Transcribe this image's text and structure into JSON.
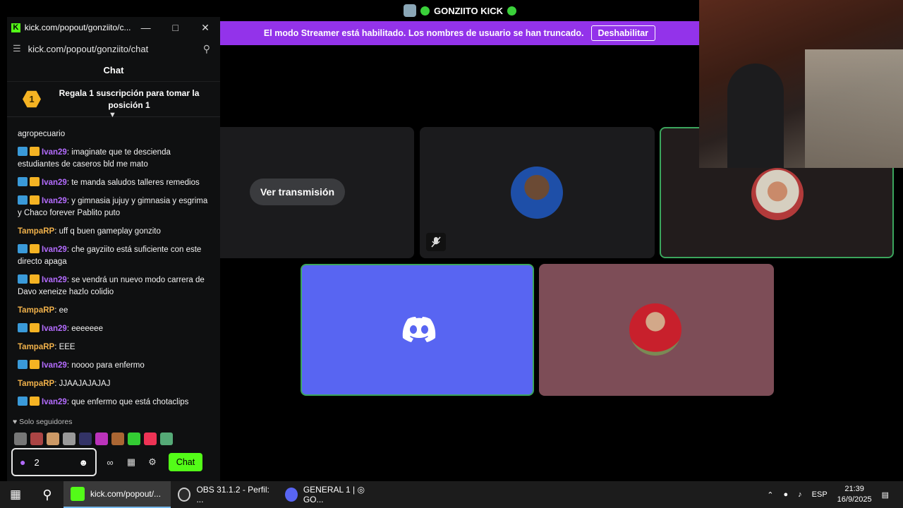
{
  "stage": {
    "channel_name": "GONZIITO KICK",
    "streamer_notice": "El modo Streamer está habilitado. Los nombres de usuario se han truncado.",
    "disable_button": "Deshabilitar",
    "watch_stream_button": "Ver transmisión"
  },
  "chat_window": {
    "title": "kick.com/popout/gonziito/c...",
    "url": "kick.com/popout/gonziito/chat",
    "panel_title": "Chat",
    "pinned": {
      "badge": "1",
      "text": "Regala 1 suscripción para tomar la posición 1"
    },
    "messages": [
      {
        "icons": false,
        "user": "",
        "text": "agropecuario",
        "color": "#ffffff"
      },
      {
        "icons": true,
        "user": "Ivan29",
        "text": ": imaginate que te descienda estudiantes de caseros bld me mato",
        "color": "#b46cff"
      },
      {
        "icons": true,
        "user": "Ivan29",
        "text": ": te manda saludos talleres remedios",
        "color": "#b46cff"
      },
      {
        "icons": true,
        "user": "Ivan29",
        "text": ": y gimnasia jujuy y gimnasia y esgrima y Chaco forever Pablito puto",
        "color": "#b46cff"
      },
      {
        "icons": false,
        "user": "TampaRP",
        "text": ": uff q buen gameplay gonzito",
        "color": "#f0b14a"
      },
      {
        "icons": true,
        "user": "Ivan29",
        "text": ": che gayziito está suficiente con este directo apaga",
        "color": "#b46cff"
      },
      {
        "icons": true,
        "user": "Ivan29",
        "text": ": se vendrá un nuevo modo carrera de Davo xeneize hazlo colidio",
        "color": "#b46cff"
      },
      {
        "icons": false,
        "user": "TampaRP",
        "text": ": ee",
        "color": "#f0b14a"
      },
      {
        "icons": true,
        "user": "Ivan29",
        "text": ": eeeeeee",
        "color": "#b46cff"
      },
      {
        "icons": false,
        "user": "TampaRP",
        "text": ": EEE",
        "color": "#f0b14a"
      },
      {
        "icons": true,
        "user": "Ivan29",
        "text": ": noooo para enfermo",
        "color": "#b46cff"
      },
      {
        "icons": false,
        "user": "TampaRP",
        "text": ": JJAAJAJAJAJ",
        "color": "#f0b14a"
      },
      {
        "icons": true,
        "user": "Ivan29",
        "text": ": que enfermo que está chotaclips",
        "color": "#b46cff"
      }
    ],
    "followers_only": "Solo seguidores",
    "input_count": "2",
    "send_button": "Chat"
  },
  "taskbar": {
    "apps": [
      {
        "label": "kick.com/popout/...",
        "icon_color": "#53fc18"
      },
      {
        "label": "OBS 31.1.2 - Perfil: ...",
        "icon_color": "#2b2b2b"
      },
      {
        "label": "GENERAL 1 | ◎ GO...",
        "icon_color": "#5865f2"
      }
    ],
    "language": "ESP",
    "time": "21:39",
    "date": "16/9/2025"
  }
}
